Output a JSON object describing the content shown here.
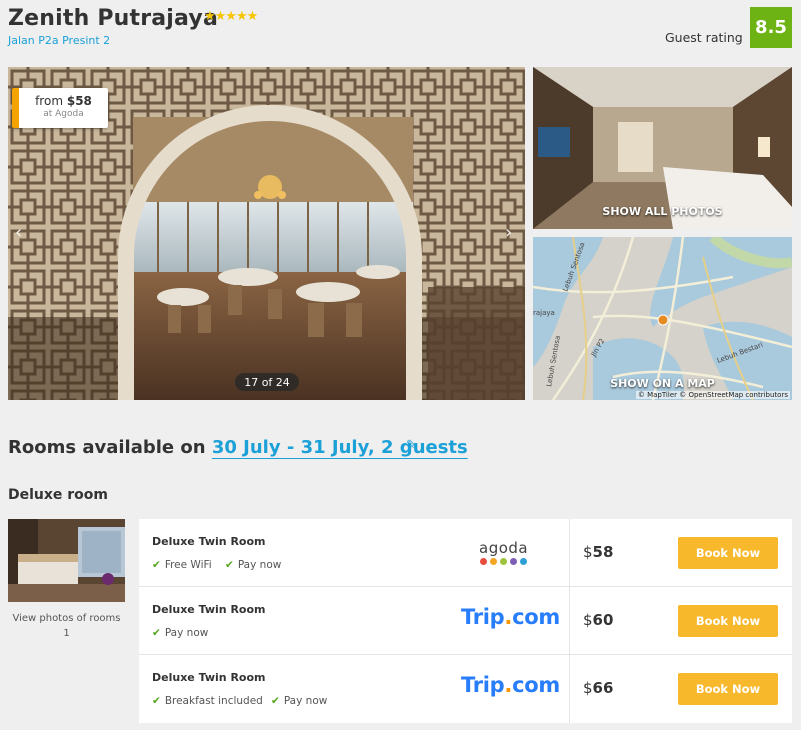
{
  "hotel": {
    "name": "Zenith Putrajaya",
    "stars": "★★★★★",
    "address": "Jalan P2a Presint 2",
    "rating_label": "Guest rating",
    "rating_value": "8.5"
  },
  "gallery": {
    "price_from_label": "from",
    "price_from_value": "$58",
    "price_source": "at Agoda",
    "counter": "17 of 24",
    "prev_arrow": "‹",
    "next_arrow": "›",
    "show_all_photos": "SHOW ALL PHOTOS",
    "show_on_map": "SHOW ON A MAP",
    "map_credit": "© MapTiler © OpenStreetMap contributors",
    "map_labels": [
      "rajaya",
      "Lebuh Sentosa",
      "Lebuh Bestari",
      "Jln P2",
      "Lebuh Sentosa"
    ]
  },
  "rooms": {
    "heading_prefix": "Rooms available on",
    "dates": "30 July - 31 July, 2 guests",
    "edit_icon": "✎",
    "room_type": "Deluxe room",
    "thumb_caption": "View photos of rooms 1",
    "offers": [
      {
        "name": "Deluxe Twin Room",
        "amenities": [
          "Free WiFi",
          "Pay now"
        ],
        "provider": "agoda",
        "currency": "$",
        "price": "58",
        "button": "Book Now"
      },
      {
        "name": "Deluxe Twin Room",
        "amenities": [
          "Pay now"
        ],
        "provider": "trip",
        "currency": "$",
        "price": "60",
        "button": "Book Now"
      },
      {
        "name": "Deluxe Twin Room",
        "amenities": [
          "Breakfast included",
          "Pay now"
        ],
        "provider": "trip",
        "currency": "$",
        "price": "66",
        "button": "Book Now"
      }
    ],
    "check_icon": "✔"
  },
  "logos": {
    "agoda_word": "agoda",
    "agoda_dot_colors": [
      "#e84c3d",
      "#f4a623",
      "#9dc43c",
      "#7f5fb5",
      "#2f9fd8"
    ],
    "trip_left": "Trip",
    "trip_dot": ".",
    "trip_right": "com"
  },
  "colors": {
    "accent_blue": "#1ba0d7",
    "rating_green": "#6cb313",
    "book_button": "#f7b82c",
    "price_tag_accent": "#f5a300"
  }
}
